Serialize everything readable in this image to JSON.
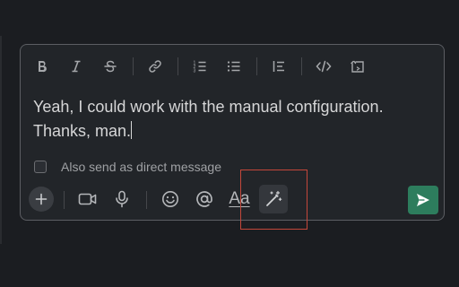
{
  "composer": {
    "message_lines": [
      "Yeah, I could work with the manual configuration.",
      "Thanks, man."
    ],
    "also_send_dm_label": "Also send as direct message",
    "also_send_dm_checked": false
  },
  "format_toolbar": {
    "buttons": [
      "bold-icon",
      "italic-icon",
      "strikethrough-icon",
      "link-icon",
      "ordered-list-icon",
      "bulleted-list-icon",
      "blockquote-icon",
      "code-icon",
      "code-block-icon"
    ]
  },
  "bottom_toolbar": {
    "buttons": [
      "plus-icon",
      "video-icon",
      "microphone-icon",
      "emoji-icon",
      "mention-icon",
      "formatting-icon",
      "magic-wand-icon"
    ],
    "formatting_label": "Aa",
    "send_button": "send-icon"
  },
  "colors": {
    "background": "#1b1d21",
    "composer_bg": "#222529",
    "border": "#5c5e63",
    "text": "#d6d6d7",
    "send_green": "#2d7d5d",
    "highlight": "#c4473a"
  }
}
